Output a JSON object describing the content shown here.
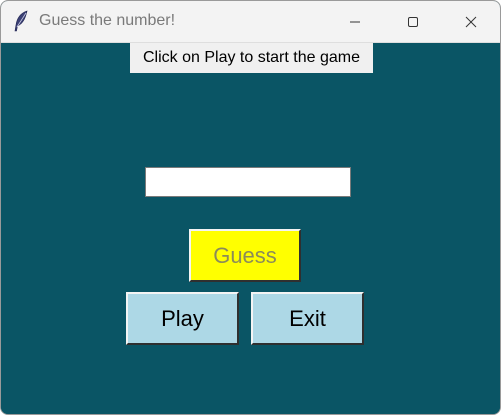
{
  "window": {
    "title": "Guess the number!",
    "app_icon": "feather-icon",
    "controls": {
      "minimize_icon": "minimize-icon",
      "maximize_icon": "maximize-icon",
      "close_icon": "close-icon"
    }
  },
  "main": {
    "status_text": "Click on Play to start the game",
    "guess_input": {
      "value": "",
      "placeholder": ""
    },
    "guess_button_label": "Guess",
    "guess_button_state": "disabled",
    "play_button_label": "Play",
    "exit_button_label": "Exit"
  },
  "colors": {
    "background": "#0a5565",
    "guess_button": "#ffff00",
    "play_exit_buttons": "#add8e6",
    "status_label_bg": "#f0f0f0"
  }
}
